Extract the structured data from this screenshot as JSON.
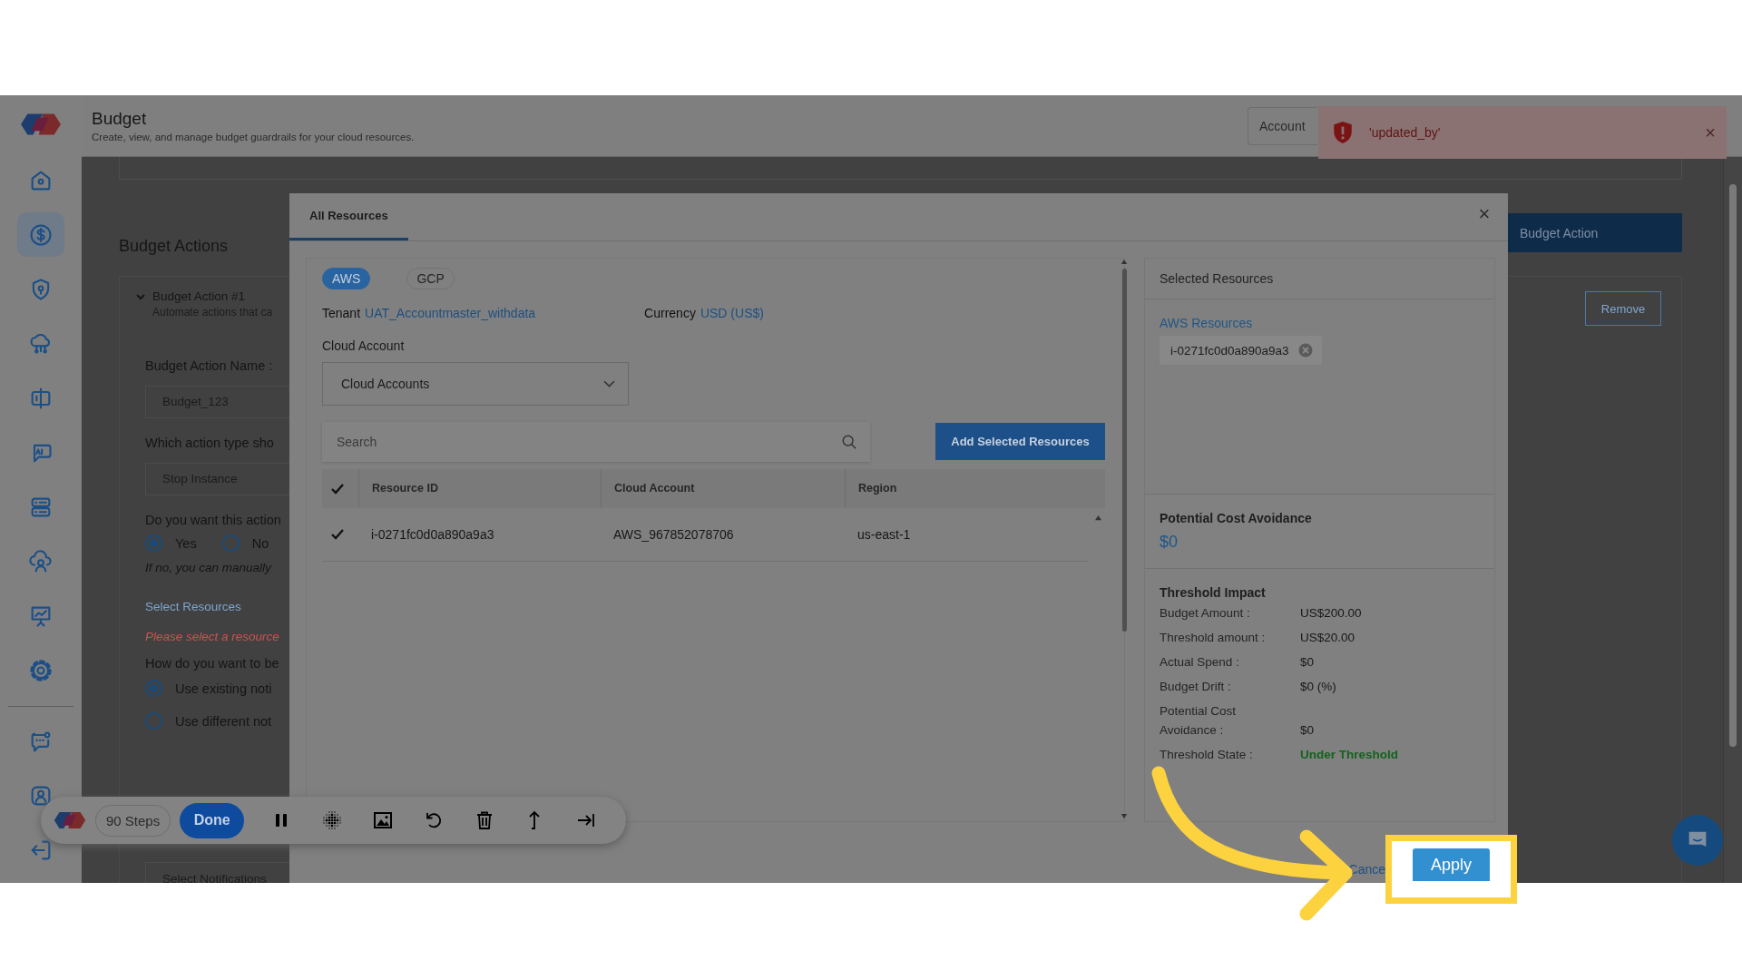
{
  "header": {
    "title": "Budget",
    "subtitle": "Create, view, and manage budget guardrails for your cloud resources.",
    "account_button": "Account"
  },
  "toast": {
    "message": "'updated_by'",
    "close": "×"
  },
  "sidebar": {
    "items": [
      {
        "selected": false
      },
      {
        "selected": true
      },
      {
        "selected": false
      },
      {
        "selected": false
      },
      {
        "selected": false
      },
      {
        "selected": false
      },
      {
        "selected": false
      },
      {
        "selected": false
      },
      {
        "selected": false
      },
      {
        "selected": false
      }
    ],
    "bottom_items": [
      {
        "selected": false
      },
      {
        "selected": false
      },
      {
        "selected": false
      }
    ]
  },
  "page": {
    "section_title": "Budget Actions",
    "action_title": "Budget Action #1",
    "expanded": true,
    "action_desc": "Automate actions that ca",
    "name_label": "Budget Action Name :",
    "name_value": "Budget_123",
    "type_label": "Which action type sho",
    "type_value": "Stop Instance",
    "auto_label": "Do you want this action",
    "auto_options": [
      {
        "label": "Yes",
        "selected": true
      },
      {
        "label": "No",
        "selected": false
      }
    ],
    "auto_hint": "If no, you can manually",
    "resources_link": "Select Resources",
    "resources_error": "Please select a resource",
    "notify_label": "How do you want to be",
    "notify_options": [
      {
        "label": "Use existing noti",
        "selected": true
      },
      {
        "label": "Use different not",
        "selected": false
      }
    ],
    "notifications_field": "Select Notifications",
    "budget_action_button": "Budget Action",
    "remove_button": "Remove"
  },
  "modal": {
    "tabs": [
      {
        "label": "All Resources",
        "selected": true
      }
    ],
    "close": "×",
    "providers": [
      {
        "label": "AWS",
        "selected": true
      },
      {
        "label": "GCP",
        "selected": false
      }
    ],
    "tenant_label": "Tenant",
    "tenant": "UAT_Accountmaster_withdata",
    "currency_label": "Currency",
    "currency": "USD (US$)",
    "cloud_account_label": "Cloud Account",
    "cloud_account_select": "Cloud Accounts",
    "search_placeholder": "Search",
    "add_button": "Add Selected Resources",
    "table": {
      "all_checked": true,
      "columns": [
        "Resource ID",
        "Cloud Account",
        "Region"
      ],
      "rows": [
        {
          "checked": true,
          "cells": [
            "i-0271fc0d0a890a9a3",
            "AWS_967852078706",
            "us-east-1"
          ]
        }
      ]
    },
    "selected_title": "Selected Resources",
    "group_title": "AWS Resources",
    "chips": [
      "i-0271fc0d0a890a9a3"
    ],
    "avoidance_title": "Potential Cost Avoidance",
    "avoidance_value": "$0",
    "impact_title": "Threshold Impact",
    "impact_rows": [
      {
        "kind": "text",
        "label": "Budget Amount :",
        "value": "US$200.00"
      },
      {
        "kind": "text",
        "label": "Threshold amount :",
        "value": "US$20.00"
      },
      {
        "kind": "text",
        "label": "Actual Spend :",
        "value": "$0"
      },
      {
        "kind": "text",
        "label": "Budget Drift :",
        "value": "$0 (%)"
      },
      {
        "kind": "text",
        "label": "Potential Cost Avoidance :",
        "value": "$0"
      },
      {
        "kind": "status",
        "label": "Threshold State :",
        "value": "Under Threshold"
      }
    ],
    "cancel": "Cance",
    "apply": "Apply"
  },
  "toolbar": {
    "steps": "90 Steps",
    "done": "Done"
  }
}
